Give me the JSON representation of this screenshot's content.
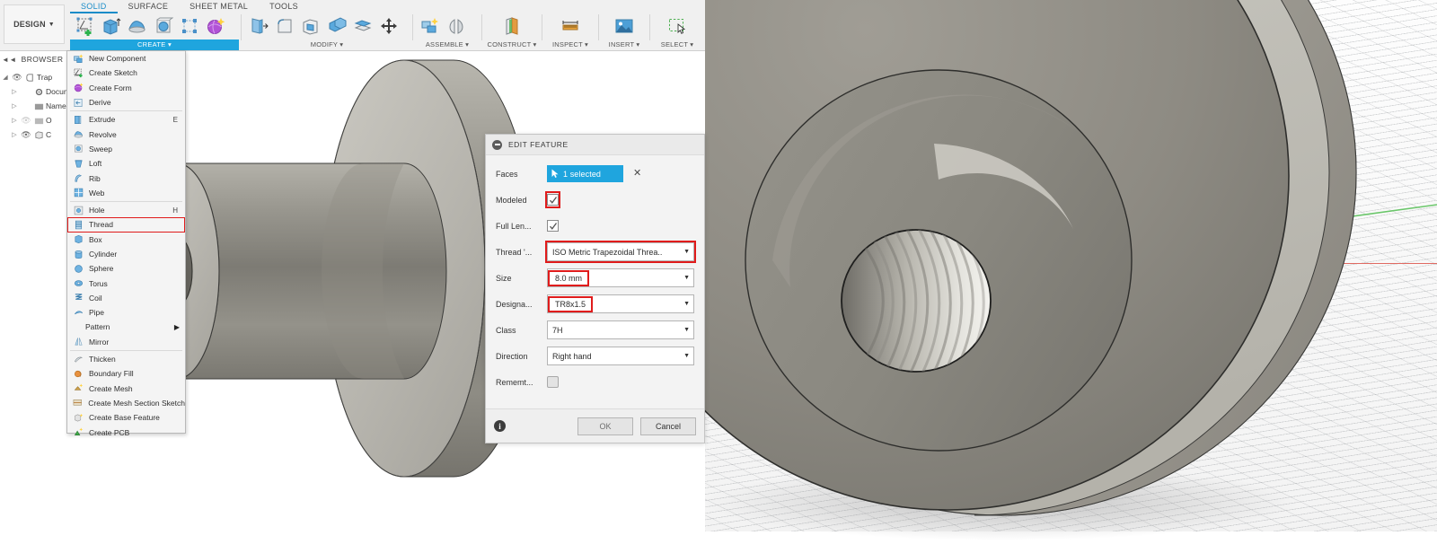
{
  "app": {
    "design_button": "DESIGN",
    "tabs": [
      {
        "label": "SOLID",
        "active": true
      },
      {
        "label": "SURFACE",
        "active": false
      },
      {
        "label": "SHEET METAL",
        "active": false
      },
      {
        "label": "TOOLS",
        "active": false
      }
    ],
    "ribbon_groups": [
      {
        "label": "CREATE",
        "highlighted": true,
        "icons": [
          "create-sketch-icon",
          "extrude-icon",
          "revolve-icon",
          "sweep-icon",
          "pattern-icon",
          "form-icon"
        ]
      },
      {
        "label": "MODIFY",
        "highlighted": false,
        "icons": [
          "press-pull-icon",
          "fillet-icon",
          "shell-icon",
          "combine-icon",
          "offset-face-icon",
          "move-copy-icon"
        ]
      },
      {
        "label": "ASSEMBLE",
        "highlighted": false,
        "icons": [
          "new-component-icon",
          "joint-icon"
        ]
      },
      {
        "label": "CONSTRUCT",
        "highlighted": false,
        "icons": [
          "offset-plane-icon"
        ]
      },
      {
        "label": "INSPECT",
        "highlighted": false,
        "icons": [
          "measure-icon"
        ]
      },
      {
        "label": "INSERT",
        "highlighted": false,
        "icons": [
          "insert-image-icon"
        ]
      },
      {
        "label": "SELECT",
        "highlighted": false,
        "icons": [
          "select-icon"
        ]
      }
    ]
  },
  "browser": {
    "title": "BROWSER",
    "collapse_icon": "collapse-panel-icon",
    "items": [
      {
        "label": "Trap",
        "icon": "component-icon",
        "eye": true,
        "twist": "down",
        "indent": 0
      },
      {
        "label": "Docum",
        "icon": "gear-icon",
        "eye": false,
        "twist": "right",
        "indent": 1
      },
      {
        "label": "Named",
        "icon": "folder-icon",
        "eye": false,
        "twist": "right",
        "indent": 1
      },
      {
        "label": "O",
        "icon": "folder-icon",
        "eye": true,
        "eye_dim": true,
        "twist": "right",
        "indent": 1
      },
      {
        "label": "C",
        "icon": "body-icon",
        "eye": true,
        "twist": "right",
        "indent": 1
      }
    ]
  },
  "create_menu": {
    "items": [
      {
        "label": "New Component",
        "icon": "new-component-icon",
        "shortcut": "",
        "sep_after": false
      },
      {
        "label": "Create Sketch",
        "icon": "create-sketch-icon",
        "shortcut": "",
        "sep_after": false
      },
      {
        "label": "Create Form",
        "icon": "create-form-icon",
        "shortcut": "",
        "sep_after": false
      },
      {
        "label": "Derive",
        "icon": "derive-icon",
        "shortcut": "",
        "sep_after": true
      },
      {
        "label": "Extrude",
        "icon": "extrude-icon",
        "shortcut": "E",
        "sep_after": false
      },
      {
        "label": "Revolve",
        "icon": "revolve-icon",
        "shortcut": "",
        "sep_after": false
      },
      {
        "label": "Sweep",
        "icon": "sweep-icon",
        "shortcut": "",
        "sep_after": false
      },
      {
        "label": "Loft",
        "icon": "loft-icon",
        "shortcut": "",
        "sep_after": false
      },
      {
        "label": "Rib",
        "icon": "rib-icon",
        "shortcut": "",
        "sep_after": false
      },
      {
        "label": "Web",
        "icon": "web-icon",
        "shortcut": "",
        "sep_after": true
      },
      {
        "label": "Hole",
        "icon": "hole-icon",
        "shortcut": "H",
        "sep_after": false
      },
      {
        "label": "Thread",
        "icon": "thread-icon",
        "shortcut": "",
        "sep_after": false,
        "highlighted": true
      },
      {
        "label": "Box",
        "icon": "box-icon",
        "shortcut": "",
        "sep_after": false
      },
      {
        "label": "Cylinder",
        "icon": "cylinder-icon",
        "shortcut": "",
        "sep_after": false
      },
      {
        "label": "Sphere",
        "icon": "sphere-icon",
        "shortcut": "",
        "sep_after": false
      },
      {
        "label": "Torus",
        "icon": "torus-icon",
        "shortcut": "",
        "sep_after": false
      },
      {
        "label": "Coil",
        "icon": "coil-icon",
        "shortcut": "",
        "sep_after": false
      },
      {
        "label": "Pipe",
        "icon": "pipe-icon",
        "shortcut": "",
        "sep_after": false
      },
      {
        "label": "Pattern",
        "icon": "",
        "shortcut": "",
        "submenu": true,
        "sep_after": false
      },
      {
        "label": "Mirror",
        "icon": "mirror-icon",
        "shortcut": "",
        "sep_after": true
      },
      {
        "label": "Thicken",
        "icon": "thicken-icon",
        "shortcut": "",
        "sep_after": false
      },
      {
        "label": "Boundary Fill",
        "icon": "boundary-fill-icon",
        "shortcut": "",
        "sep_after": false
      },
      {
        "label": "Create Mesh",
        "icon": "create-mesh-icon",
        "shortcut": "",
        "sep_after": false
      },
      {
        "label": "Create Mesh Section Sketch",
        "icon": "mesh-section-icon",
        "shortcut": "",
        "sep_after": false
      },
      {
        "label": "Create Base Feature",
        "icon": "base-feature-icon",
        "shortcut": "",
        "sep_after": false
      },
      {
        "label": "Create PCB",
        "icon": "create-pcb-icon",
        "shortcut": "",
        "sep_after": false
      }
    ]
  },
  "edit_feature": {
    "title": "EDIT FEATURE",
    "collapse_icon": "collapse-icon",
    "rows": [
      {
        "label": "Faces",
        "type": "selection",
        "value": "1 selected",
        "clear_icon": "clear-selection-icon"
      },
      {
        "label": "Modeled",
        "type": "checkbox",
        "checked": true,
        "highlighted": true
      },
      {
        "label": "Full Len...",
        "type": "checkbox",
        "checked": true,
        "highlighted": false
      },
      {
        "label": "Thread '...",
        "type": "combo",
        "value": "ISO Metric Trapezoidal Threa..",
        "highlighted": true
      },
      {
        "label": "Size",
        "type": "combo",
        "value": "8.0 mm",
        "highlighted": true,
        "value_only_box": true
      },
      {
        "label": "Designa...",
        "type": "combo",
        "value": "TR8x1.5",
        "highlighted": true,
        "value_only_box": true
      },
      {
        "label": "Class",
        "type": "combo",
        "value": "7H",
        "highlighted": false
      },
      {
        "label": "Direction",
        "type": "combo",
        "value": "Right hand",
        "highlighted": false
      },
      {
        "label": "Rememt...",
        "type": "checkbox",
        "checked": false,
        "highlighted": false
      }
    ],
    "info_icon": "info-icon",
    "ok_label": "OK",
    "cancel_label": "Cancel"
  },
  "colors": {
    "accent": "#1fa5de",
    "highlight_red": "#e01b1b",
    "axis_x": "#e06a62",
    "axis_y": "#5bbf5b",
    "model_gray": "#8d8b84"
  },
  "viewport_left": {
    "name": "modeling-viewport-left",
    "model": "flanged-bushing-with-threaded-bore"
  },
  "viewport_right": {
    "name": "modeling-viewport-right",
    "model": "flanged-bushing-threaded-bore-zoomed"
  }
}
